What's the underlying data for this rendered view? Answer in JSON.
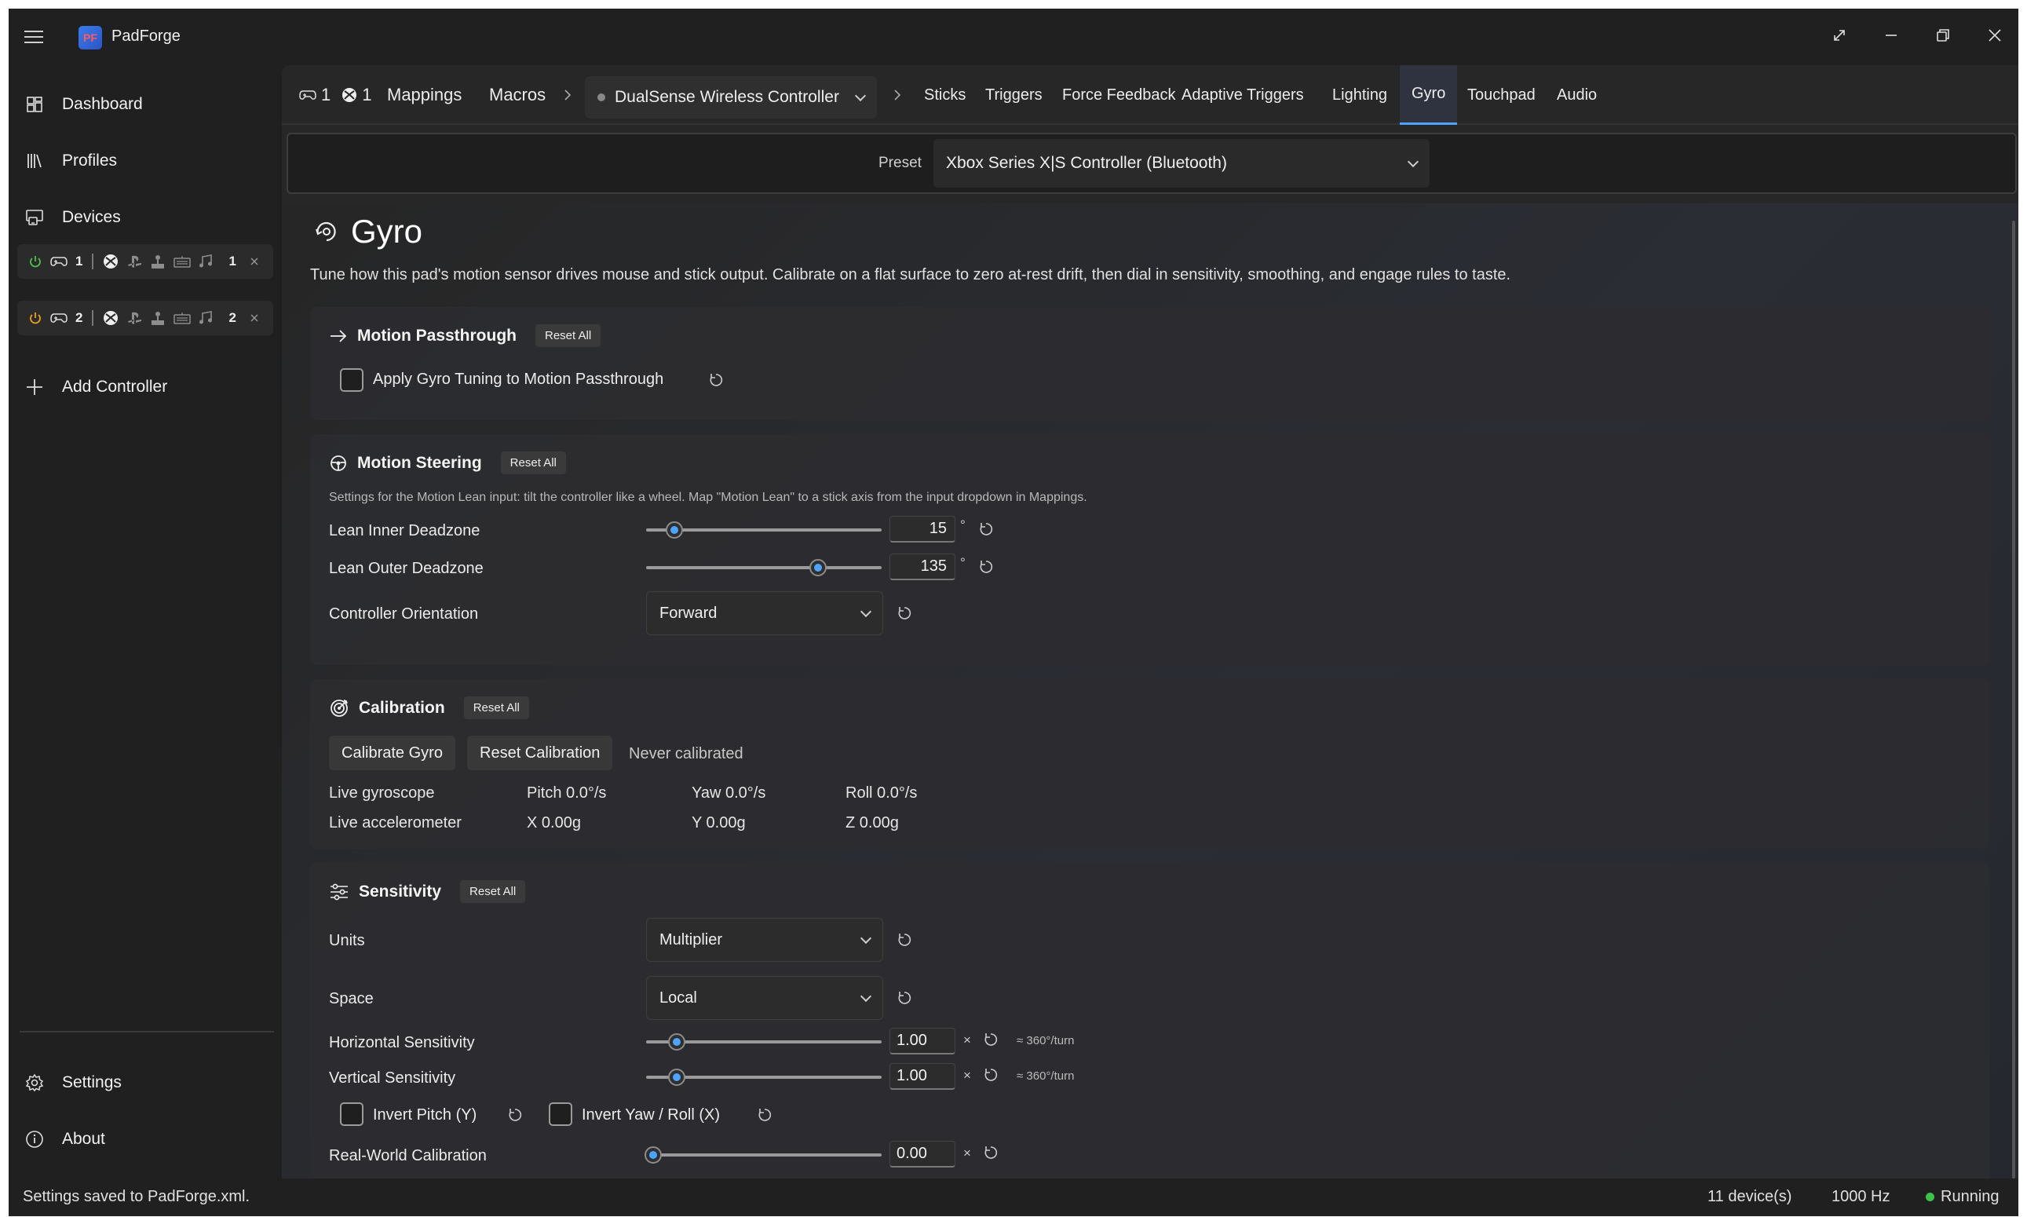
{
  "app": {
    "title": "PadForge",
    "logo_text": "PF"
  },
  "sidebar": {
    "items": [
      {
        "label": "Dashboard",
        "icon": "dashboard-icon"
      },
      {
        "label": "Profiles",
        "icon": "library-icon"
      },
      {
        "label": "Devices",
        "icon": "devices-icon"
      }
    ],
    "slots": [
      {
        "number": "1",
        "count": "1",
        "power_color": "#4cc24c"
      },
      {
        "number": "2",
        "count": "2",
        "power_color": "#f0a020"
      }
    ],
    "add_controller": "Add Controller",
    "settings": "Settings",
    "about": "About"
  },
  "topnav": {
    "badge_gamepad": "1",
    "badge_xbox": "1",
    "mappings": "Mappings",
    "macros": "Macros",
    "device": "DualSense Wireless Controller",
    "tabs": [
      "Sticks",
      "Triggers",
      "Force Feedback",
      "Adaptive Triggers",
      "Lighting",
      "Gyro",
      "Touchpad",
      "Audio"
    ],
    "active_tab": "Gyro"
  },
  "preset": {
    "label": "Preset",
    "value": "Xbox Series X|S Controller (Bluetooth)"
  },
  "page": {
    "title": "Gyro",
    "description": "Tune how this pad's motion sensor drives mouse and stick output. Calibrate on a flat surface to zero at-rest drift, then dial in sensitivity, smoothing, and engage rules to taste."
  },
  "reset_all": "Reset All",
  "motion_passthrough": {
    "title": "Motion Passthrough",
    "checkbox_label": "Apply Gyro Tuning to Motion Passthrough",
    "checked": false
  },
  "motion_steering": {
    "title": "Motion Steering",
    "description": "Settings for the Motion Lean input: tilt the controller like a wheel. Map \"Motion Lean\" to a stick axis from the input dropdown in Mappings.",
    "inner_label": "Lean Inner Deadzone",
    "inner_value": "15",
    "inner_fraction": 0.12,
    "outer_label": "Lean Outer Deadzone",
    "outer_value": "135",
    "outer_fraction": 0.73,
    "degree_unit": "°",
    "orientation_label": "Controller Orientation",
    "orientation_value": "Forward"
  },
  "calibration": {
    "title": "Calibration",
    "calibrate_button": "Calibrate Gyro",
    "reset_button": "Reset Calibration",
    "status": "Never calibrated",
    "gyro_label": "Live gyroscope",
    "pitch": "Pitch 0.0°/s",
    "yaw": "Yaw 0.0°/s",
    "roll": "Roll 0.0°/s",
    "accel_label": "Live accelerometer",
    "ax": "X 0.00g",
    "ay": "Y 0.00g",
    "az": "Z 0.00g"
  },
  "sensitivity": {
    "title": "Sensitivity",
    "units_label": "Units",
    "units_value": "Multiplier",
    "space_label": "Space",
    "space_value": "Local",
    "h_label": "Horizontal Sensitivity",
    "h_value": "1.00",
    "h_fraction": 0.13,
    "v_label": "Vertical Sensitivity",
    "v_value": "1.00",
    "v_fraction": 0.13,
    "times": "×",
    "turn_note": "≈ 360°/turn",
    "invert_pitch": "Invert Pitch (Y)",
    "invert_yaw": "Invert Yaw / Roll (X)",
    "rw_label": "Real-World Calibration",
    "rw_value": "0.00",
    "rw_fraction": 0.03
  },
  "status": {
    "message": "Settings saved to PadForge.xml.",
    "devices": "11 device(s)",
    "rate": "1000 Hz",
    "state": "Running",
    "state_color": "#3cc24a"
  }
}
